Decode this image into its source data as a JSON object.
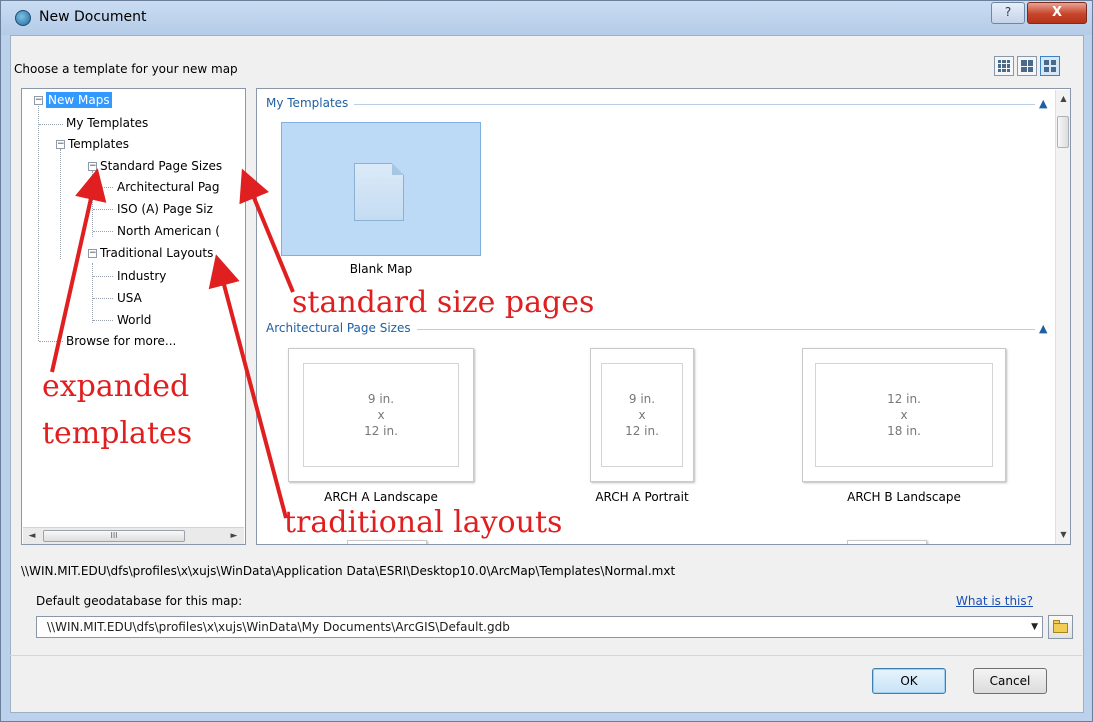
{
  "window": {
    "title": "New Document",
    "help_glyph": "?",
    "close_glyph": "X"
  },
  "prompt": "Choose a template for your new map",
  "tree": {
    "items": [
      {
        "label": "New Maps"
      },
      {
        "label": "My Templates"
      },
      {
        "label": "Templates"
      },
      {
        "label": "Standard Page Sizes"
      },
      {
        "label": "Architectural Pag"
      },
      {
        "label": "ISO (A) Page Siz"
      },
      {
        "label": "North American ("
      },
      {
        "label": "Traditional Layouts"
      },
      {
        "label": "Industry"
      },
      {
        "label": "USA"
      },
      {
        "label": "World"
      },
      {
        "label": "Browse for more..."
      }
    ],
    "expand_glyph": "−",
    "scroll_thumb_glyph": "III",
    "scroll_left": "◄",
    "scroll_right": "►"
  },
  "gallery": {
    "sections": [
      {
        "title": "My Templates",
        "collapse_glyph": "▲"
      },
      {
        "title": "Architectural Page Sizes",
        "collapse_glyph": "▲"
      }
    ],
    "blank_map_caption": "Blank Map",
    "pages": [
      {
        "size": [
          "9 in.",
          "x",
          "12 in."
        ],
        "caption": "ARCH A Landscape"
      },
      {
        "size": [
          "9 in.",
          "x",
          "12 in."
        ],
        "caption": "ARCH A Portrait"
      },
      {
        "size": [
          "12 in.",
          "x",
          "18 in."
        ],
        "caption": "ARCH B Landscape"
      }
    ],
    "scroll_up": "▲",
    "scroll_down": "▼"
  },
  "template_path": "\\\\WIN.MIT.EDU\\dfs\\profiles\\x\\xujs\\WinData\\Application Data\\ESRI\\Desktop10.0\\ArcMap\\Templates\\Normal.mxt",
  "geodatabase": {
    "label": "Default geodatabase for this map:",
    "help_link": "What is this?",
    "value": "\\\\WIN.MIT.EDU\\dfs\\profiles\\x\\xujs\\WinData\\My Documents\\ArcGIS\\Default.gdb",
    "dropdown_glyph": "▼"
  },
  "buttons": {
    "ok": "OK",
    "cancel": "Cancel"
  },
  "annotations": {
    "standard": "standard size pages",
    "expanded_line1": "expanded",
    "expanded_line2": "templates",
    "traditional": "traditional layouts",
    "color": "#e02020"
  }
}
